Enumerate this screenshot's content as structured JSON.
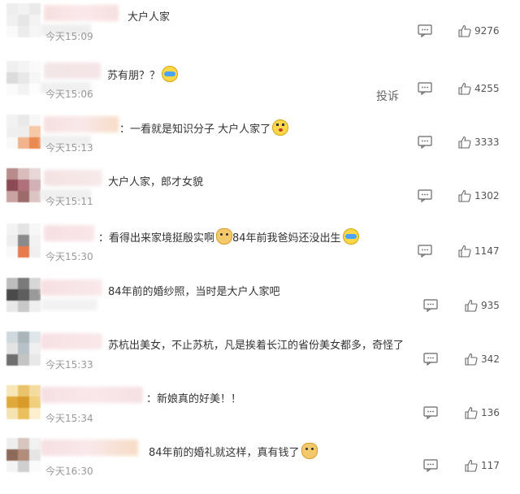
{
  "report_label": "投诉",
  "comments": [
    {
      "text": "大户人家",
      "emoji": null,
      "time": "今天15:09",
      "likes": "9276"
    },
    {
      "text": "苏有朋？？",
      "emoji": "cry",
      "time": "今天15:06",
      "likes": "4255"
    },
    {
      "text": "：一看就是知识分子 大户人家了",
      "emoji": "think",
      "time": "今天15:13",
      "likes": "3333"
    },
    {
      "text": "大户人家，郎才女貌",
      "emoji": null,
      "time": "今天15:11",
      "likes": "1302"
    },
    {
      "text": "：看得出来家境挺殷实啊",
      "emoji": "doge",
      "text2": "84年前我爸妈还没出生",
      "emoji2": "cry",
      "time": "今天15:30",
      "likes": "1147"
    },
    {
      "text": "84年前的婚纱照，当时是大户人家吧",
      "emoji": null,
      "time": "",
      "likes": "935"
    },
    {
      "text": "苏杭出美女，不止苏杭，凡是挨着长江的省份美女都多，奇怪了",
      "emoji": null,
      "time": "今天15:33",
      "likes": "342"
    },
    {
      "text": "：新娘真的好美！！",
      "emoji": null,
      "time": "今天15:34",
      "likes": "136"
    },
    {
      "text": "84年前的婚礼就这样，真有钱了",
      "emoji": "doge",
      "time": "今天16:30",
      "likes": "117"
    }
  ]
}
